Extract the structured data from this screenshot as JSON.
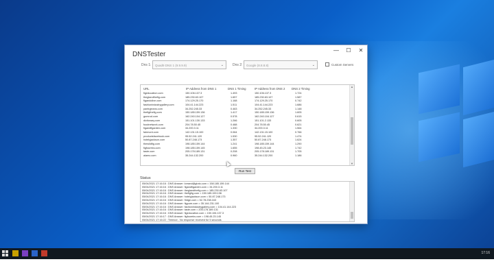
{
  "window": {
    "title": "DNSTester",
    "controls": [
      "—",
      "☐",
      "✕"
    ]
  },
  "dns_config": {
    "dns1_label": "Dns 1:",
    "dns1_value": "Quad9 DNS 1 (9.9.9.9)",
    "dns2_label": "Dns 2:",
    "dns2_value": "Google (8.8.8.8)",
    "custom_servers_label": "Custom Servers"
  },
  "results": {
    "columns": [
      "URL",
      "IP Address from DNS 1",
      "DNS 1 Timing",
      "IP Address from DNS 2",
      "DNS 2 Timing"
    ],
    "rows": [
      [
        "figeducation.com",
        "150.106.137.3",
        "1.493",
        "150.106.137.3",
        "1.724"
      ],
      [
        "theglandthefig.com",
        "185.230.63.107",
        "1.657",
        "185.230.63.107",
        "1.587"
      ],
      [
        "figandolive.com",
        "174.129.25.170",
        "1.168",
        "174.129.25.170",
        "0.742"
      ],
      [
        "fashionindustrygallery.com",
        "104.41.144.223",
        "1.511",
        "104.41.144.223",
        "1.686"
      ],
      [
        "pantryjeans.com",
        "34.252.245.33",
        "0.463",
        "34.252.245.33",
        "1.148"
      ],
      [
        "thefigthefig.com",
        "150.185.159.136",
        "1.417",
        "150.185.159.136",
        "1.605"
      ],
      [
        "gumrod.com",
        "162.240.104.127",
        "0.578",
        "162.240.104.127",
        "0.615"
      ],
      [
        "dictionary.com",
        "151.101.130.133",
        "1.266",
        "151.101.2.133",
        "0.605"
      ],
      [
        "foodnetwork.com",
        "204.78.50.45",
        "0.488",
        "204.78.50.45",
        "0.621"
      ],
      [
        "figandfigarden.com",
        "34.200.3.11",
        "1.330",
        "34.200.3.11",
        "1.564"
      ],
      [
        "fairmont.com",
        "142.131.15.100",
        "0.064",
        "142.131.15.100",
        "0.766"
      ],
      [
        "productsfacebook.com",
        "95.52.241.120",
        "1.530",
        "95.52.241.120",
        "1.474"
      ],
      [
        "hotelyjackson.com",
        "50.87.248.173",
        "1.357",
        "50.87.248.173",
        "1.624"
      ],
      [
        "thewildfig.com",
        "198.185.159.144",
        "1.241",
        "198.185.159.144",
        "1.290"
      ],
      [
        "figfoureks.com",
        "198.185.159.145",
        "1.655",
        "198.45.23.145",
        "1.742"
      ],
      [
        "taste.com",
        "205.178.189.131",
        "0.208",
        "205.178.189.131",
        "1.705"
      ],
      [
        "alamo.com",
        "35.244.132.200",
        "0.960",
        "35.244.132.200",
        "1.186"
      ]
    ]
  },
  "run_button": "Run Test",
  "status": {
    "label": "Status",
    "lines": [
      "05/04/2021 17:16:16 : DNS Answer: lorrand@gtoto.com = 158.185.159.144",
      "05/04/2021 17:16:16 : DNS Answer: figandfigarden.com = 34.200.3.11",
      "05/04/2021 17:16:16 : DNS Answer: theglandthefig.com = 185.230.63.107",
      "05/04/2021 17:16:16 : DNS Answer: thefigfig.com = 150.185.159.136",
      "05/04/2021 17:16:16 : DNS Answer: hotelyjackson.com = 50.87.248.173",
      "05/04/2021 17:16:16 : DNS Answer: fridge.com = 52.78.238.163",
      "05/04/2021 17:16:16 : DNS Answer: figpure.com = 35.144.231.100",
      "05/04/2021 17:16:16 : DNS Answer: fashionindustrygallery.com = 104.41.144.223",
      "05/04/2021 17:16:16 : DNS Answer: taste.com = 205.178.189.131",
      "05/04/2021 17:16:16 : DNS Answer: figeducation.com = 150.106.137.3",
      "05/04/2021 17:16:17 : DNS Answer: figfoureks.com = 198.45.23.145",
      "05/04/2021 17:16:22 : Timeout - No response received for 5 seconds"
    ]
  },
  "taskbar": {
    "clock": "17:16"
  },
  "colors": {
    "desktop_blue": "#0a5fc8",
    "taskbar": "#101820"
  }
}
